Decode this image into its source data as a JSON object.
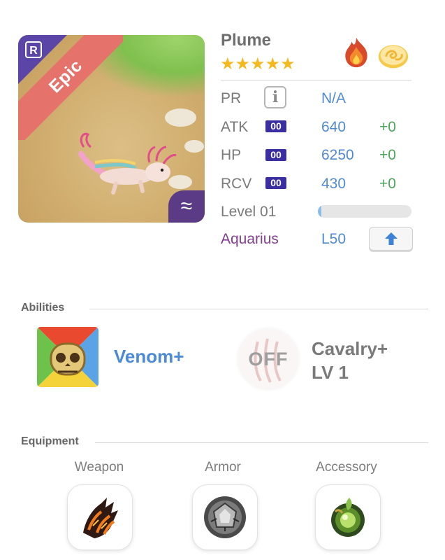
{
  "creature": {
    "name": "Plume",
    "rarity": "Epic",
    "rarity_badge": "R",
    "star_count": 5,
    "stars": "★★★★★",
    "habitat_glyph": "≈",
    "elements": [
      "fire-element-icon",
      "air-element-icon"
    ]
  },
  "stats": {
    "pr": {
      "label": "PR",
      "info_glyph": "i",
      "value": "N/A"
    },
    "atk": {
      "label": "ATK",
      "badge": "00",
      "value": "640",
      "bonus": "+0"
    },
    "hp": {
      "label": "HP",
      "badge": "00",
      "value": "6250",
      "bonus": "+0"
    },
    "rcv": {
      "label": "RCV",
      "badge": "00",
      "value": "430",
      "bonus": "+0"
    },
    "level": {
      "label": "Level 01",
      "progress": 0.04
    },
    "sign": {
      "label": "Aquarius",
      "level": "L50"
    }
  },
  "abilities": {
    "title": "Abilities",
    "primary": {
      "name": "Venom+"
    },
    "secondary": {
      "status": "OFF",
      "name_line1": "Cavalry+",
      "name_line2": "LV 1"
    }
  },
  "equipment": {
    "title": "Equipment",
    "slots": [
      {
        "label": "Weapon",
        "icon": "lava-claw-icon"
      },
      {
        "label": "Armor",
        "icon": "stone-armor-icon"
      },
      {
        "label": "Accessory",
        "icon": "green-gem-icon"
      }
    ]
  },
  "colors": {
    "stat_value": "#4f8ad1",
    "stat_bonus": "#4aa55a",
    "sign": "#843e91",
    "badge": "#3a2ea0",
    "rarity_ribbon": "#e5736b",
    "star": "#f5b81e"
  }
}
